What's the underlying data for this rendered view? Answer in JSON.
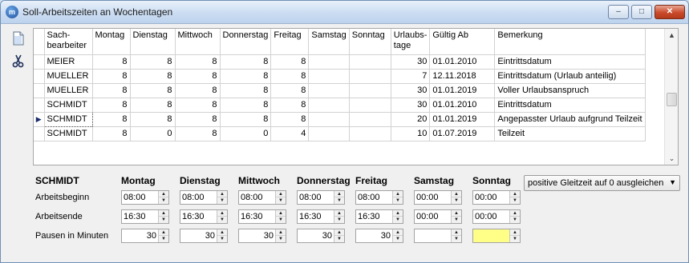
{
  "window": {
    "title": "Soll-Arbeitszeiten an Wochentagen",
    "minimize": "–",
    "maximize": "□",
    "close": "✕"
  },
  "toolbar": {
    "icons": [
      "new-record-icon",
      "scissors-icon"
    ]
  },
  "grid": {
    "columns": [
      "Sach-\nbearbeiter",
      "Montag",
      "Dienstag",
      "Mittwoch",
      "Donnerstag",
      "Freitag",
      "Samstag",
      "Sonntag",
      "Urlaubs-\ntage",
      "Gültig Ab",
      "Bemerkung"
    ],
    "rows": [
      [
        "MEIER",
        "8",
        "8",
        "8",
        "8",
        "8",
        "",
        "",
        "30",
        "01.01.2010",
        "Eintrittsdatum"
      ],
      [
        "MUELLER",
        "8",
        "8",
        "8",
        "8",
        "8",
        "",
        "",
        "7",
        "12.11.2018",
        "Eintrittsdatum (Urlaub anteilig)"
      ],
      [
        "MUELLER",
        "8",
        "8",
        "8",
        "8",
        "8",
        "",
        "",
        "30",
        "01.01.2019",
        "Voller Urlaubsanspruch"
      ],
      [
        "SCHMIDT",
        "8",
        "8",
        "8",
        "8",
        "8",
        "",
        "",
        "30",
        "01.01.2010",
        "Eintrittsdatum"
      ],
      [
        "SCHMIDT",
        "8",
        "8",
        "8",
        "8",
        "8",
        "",
        "",
        "20",
        "01.01.2019",
        "Angepasster Urlaub aufgrund Teilzeit"
      ],
      [
        "SCHMIDT",
        "8",
        "0",
        "8",
        "0",
        "4",
        "",
        "",
        "10",
        "01.07.2019",
        "Teilzeit"
      ]
    ],
    "current_row_index": 4,
    "current_row_marker": "▶"
  },
  "form": {
    "employee": "SCHMIDT",
    "days": [
      "Montag",
      "Dienstag",
      "Mittwoch",
      "Donnerstag",
      "Freitag",
      "Samstag",
      "Sonntag"
    ],
    "labels": {
      "start": "Arbeitsbeginn",
      "end": "Arbeitsende",
      "breaks": "Pausen in Minuten"
    },
    "start": [
      "08:00",
      "08:00",
      "08:00",
      "08:00",
      "08:00",
      "00:00",
      "00:00"
    ],
    "end": [
      "16:30",
      "16:30",
      "16:30",
      "16:30",
      "16:30",
      "00:00",
      "00:00"
    ],
    "breaks": [
      "30",
      "30",
      "30",
      "30",
      "30",
      "",
      ""
    ],
    "highlight_color": "#ffff88",
    "gleitzeit_option": "positive Gleitzeit auf 0 ausgleichen"
  }
}
